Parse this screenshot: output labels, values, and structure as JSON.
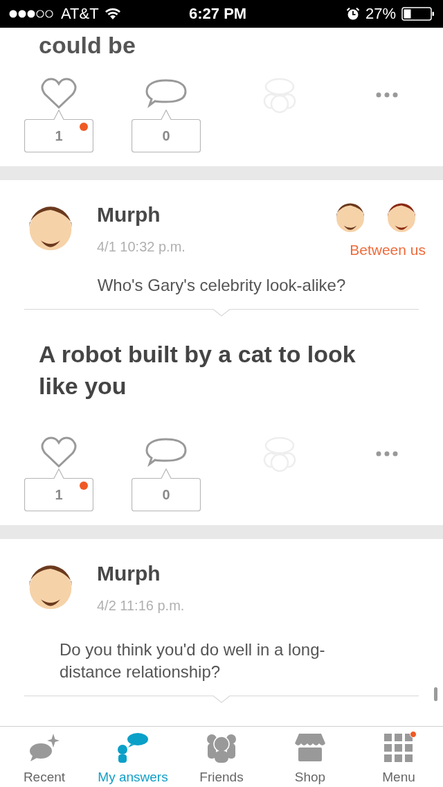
{
  "status_bar": {
    "carrier": "AT&T",
    "time": "6:27 PM",
    "battery": "27%"
  },
  "posts": [
    {
      "answer": "could be",
      "likes": "1",
      "new_like": true,
      "comments": "0"
    },
    {
      "author": "Murph",
      "time": "4/1 10:32 p.m.",
      "audience": "Between us",
      "question": "Who's Gary's celebrity look-alike?",
      "answer": "A robot built by a cat to look like you",
      "likes": "1",
      "new_like": true,
      "comments": "0"
    },
    {
      "author": "Murph",
      "time": "4/2 11:16 p.m.",
      "question": "Do you think you'd do well in a long-distance relationship?"
    }
  ],
  "tabs": [
    {
      "kind": "recent",
      "label": "Recent",
      "selected": false,
      "badge": false
    },
    {
      "kind": "answers",
      "label": "My answers",
      "selected": true,
      "badge": false
    },
    {
      "kind": "friends",
      "label": "Friends",
      "selected": false,
      "badge": false
    },
    {
      "kind": "shop",
      "label": "Shop",
      "selected": false,
      "badge": false
    },
    {
      "kind": "menu",
      "label": "Menu",
      "selected": false,
      "badge": true
    }
  ]
}
